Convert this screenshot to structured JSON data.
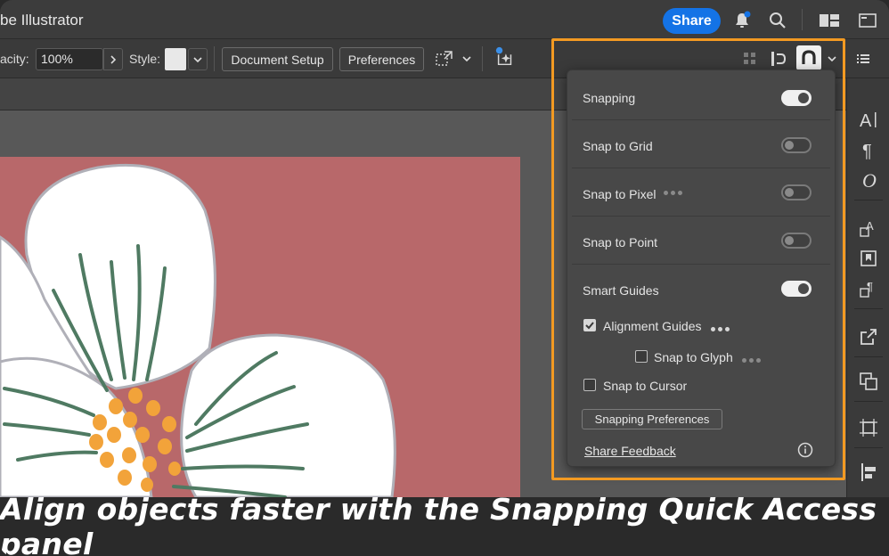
{
  "app": {
    "title": "be Illustrator"
  },
  "titlebar": {
    "share_label": "Share"
  },
  "controlbar": {
    "opacity_label": "acity:",
    "opacity_value": "100%",
    "style_label": "Style:",
    "document_setup_label": "Document Setup",
    "preferences_label": "Preferences"
  },
  "snapping_panel": {
    "rows": [
      {
        "label": "Snapping",
        "on": true
      },
      {
        "label": "Snap to Grid",
        "on": false
      },
      {
        "label": "Snap to Pixel",
        "on": false
      },
      {
        "label": "Snap to Point",
        "on": false
      },
      {
        "label": "Smart Guides",
        "on": true
      }
    ],
    "checkboxes": [
      {
        "label": "Alignment Guides",
        "checked": true
      },
      {
        "label": "Snap to Glyph",
        "checked": false
      },
      {
        "label": "Snap to Cursor",
        "checked": false
      }
    ],
    "preferences_button": "Snapping Preferences",
    "feedback_link": "Share Feedback"
  },
  "caption": {
    "text": "Align objects faster with the Snapping Quick Access panel"
  },
  "colors": {
    "accent": "#1473e6",
    "highlight": "#f39a22",
    "artboard": "#b8686a",
    "petal": "#ffffff",
    "vein": "#4f7a62",
    "stamen": "#f2a33a"
  }
}
